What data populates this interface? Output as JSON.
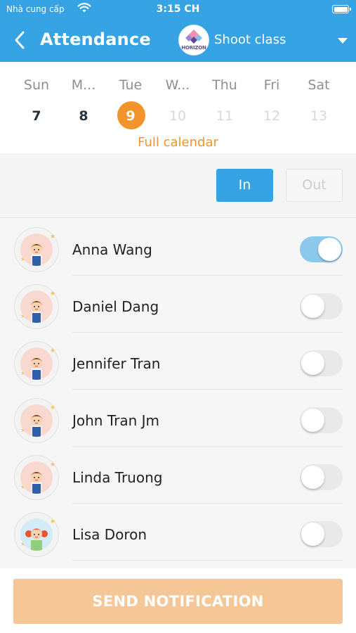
{
  "status_bar": {
    "carrier": "Nhà cung cấp",
    "time": "3:15 CH"
  },
  "header": {
    "title": "Attendance",
    "class_logo_text": "HORIZON",
    "class_name": "Shoot class",
    "back_icon": "chevron-left-icon",
    "dropdown_icon": "caret-down-icon"
  },
  "week": {
    "days": [
      {
        "name": "Sun",
        "num": "7",
        "state": "past"
      },
      {
        "name": "M...",
        "num": "8",
        "state": "past"
      },
      {
        "name": "Tue",
        "num": "9",
        "state": "selected"
      },
      {
        "name": "W...",
        "num": "10",
        "state": "future"
      },
      {
        "name": "Thu",
        "num": "11",
        "state": "future"
      },
      {
        "name": "Fri",
        "num": "12",
        "state": "future"
      },
      {
        "name": "Sat",
        "num": "13",
        "state": "future"
      }
    ],
    "full_calendar_label": "Full calendar"
  },
  "filter": {
    "in_label": "In",
    "out_label": "Out",
    "active": "In"
  },
  "students": [
    {
      "name": "Anna Wang",
      "checked_in": true,
      "avatar": "boy-avatar"
    },
    {
      "name": "Daniel Dang",
      "checked_in": false,
      "avatar": "boy-avatar"
    },
    {
      "name": "Jennifer Tran",
      "checked_in": false,
      "avatar": "boy-avatar"
    },
    {
      "name": "John Tran Jm",
      "checked_in": false,
      "avatar": "boy-avatar"
    },
    {
      "name": "Linda Truong",
      "checked_in": false,
      "avatar": "boy-avatar"
    },
    {
      "name": "Lisa Doron",
      "checked_in": false,
      "avatar": "girl-avatar"
    }
  ],
  "footer": {
    "send_label": "SEND NOTIFICATION"
  },
  "colors": {
    "primary": "#35a3e4",
    "accent": "#f3932b",
    "toggle_on": "#8cc9ec",
    "send_button": "#f5c797"
  }
}
